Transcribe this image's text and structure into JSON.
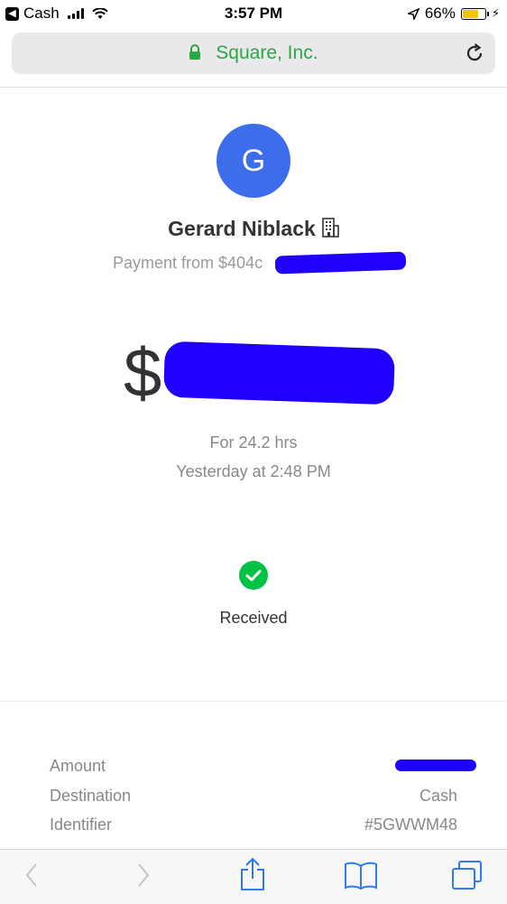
{
  "status_bar": {
    "back_app": "Cash",
    "time": "3:57 PM",
    "battery_percent": "66%",
    "battery_level": 0.66
  },
  "browser": {
    "site_title": "Square, Inc.",
    "accent_color": "#28a745"
  },
  "payment": {
    "avatar_initial": "G",
    "avatar_color": "#3d6dea",
    "sender_name": "Gerard Niblack",
    "subtitle": "Payment from $404c",
    "amount_prefix": "$",
    "duration": "For 24.2 hrs",
    "timestamp": "Yesterday at 2:48 PM",
    "status": "Received",
    "status_color": "#00c244"
  },
  "details": [
    {
      "label": "Amount",
      "value": ""
    },
    {
      "label": "Destination",
      "value": "Cash"
    },
    {
      "label": "Identifier",
      "value": "#5GWWM48"
    }
  ],
  "toolbar": {
    "icons": [
      "back-arrow-icon",
      "forward-arrow-icon",
      "share-icon",
      "bookmarks-icon",
      "tabs-icon"
    ]
  }
}
